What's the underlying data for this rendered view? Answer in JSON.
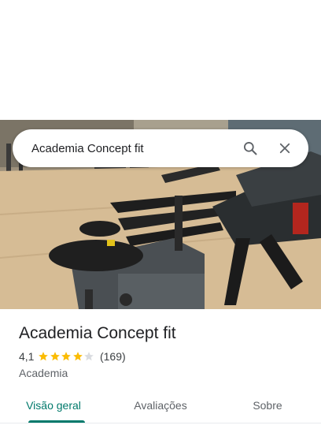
{
  "search": {
    "query": "Academia Concept fit"
  },
  "place": {
    "title": "Academia Concept fit",
    "rating_value": "4,1",
    "stars_filled": 4,
    "stars_total": 5,
    "review_count": "(169)",
    "category": "Academia"
  },
  "tabs": [
    {
      "label": "Visão geral",
      "active": true
    },
    {
      "label": "Avaliações",
      "active": false
    },
    {
      "label": "Sobre",
      "active": false
    }
  ],
  "colors": {
    "accent": "#00796b",
    "star_filled": "#fbbc04",
    "star_empty": "#dadce0"
  }
}
